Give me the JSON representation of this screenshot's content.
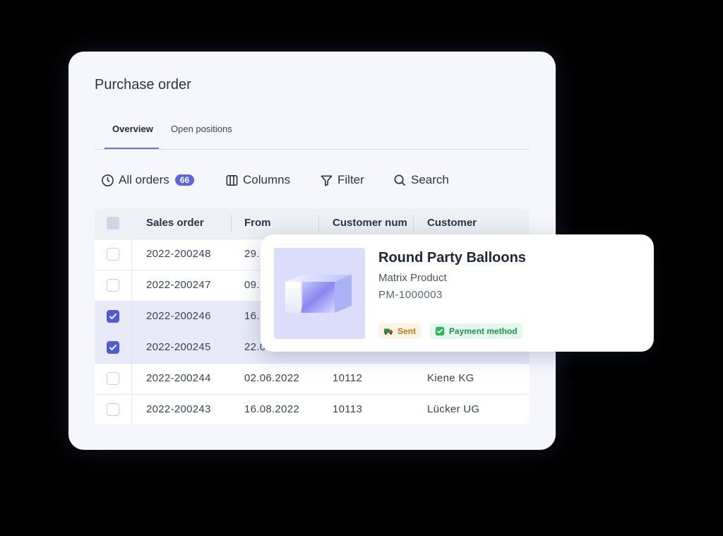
{
  "panel": {
    "title": "Purchase order",
    "tabs": [
      {
        "label": "Overview",
        "active": true
      },
      {
        "label": "Open positions",
        "active": false
      }
    ]
  },
  "toolbar": {
    "all_orders_label": "All orders",
    "all_orders_count": "66",
    "columns_label": "Columns",
    "filter_label": "Filter",
    "search_label": "Search"
  },
  "table": {
    "headers": [
      "Sales order",
      "From",
      "Customer num",
      "Customer"
    ],
    "rows": [
      {
        "sales_order": "2022-200248",
        "from": "29.",
        "customer_num": "",
        "customer": "",
        "checked": false
      },
      {
        "sales_order": "2022-200247",
        "from": "09.",
        "customer_num": "",
        "customer": "",
        "checked": false
      },
      {
        "sales_order": "2022-200246",
        "from": "16.",
        "customer_num": "",
        "customer": "",
        "checked": true
      },
      {
        "sales_order": "2022-200245",
        "from": "22.0",
        "customer_num": "",
        "customer": "",
        "checked": true
      },
      {
        "sales_order": "2022-200244",
        "from": "02.06.2022",
        "customer_num": "10112",
        "customer": "Kiene KG",
        "checked": false
      },
      {
        "sales_order": "2022-200243",
        "from": "16.08.2022",
        "customer_num": "10113",
        "customer": "Lücker UG",
        "checked": false
      }
    ]
  },
  "product_card": {
    "title": "Round Party Balloons",
    "subtitle": "Matrix Product",
    "code": "PM-1000003",
    "chips": [
      {
        "label": "Sent",
        "icon": "truck-icon",
        "color": "#c27a1c"
      },
      {
        "label": "Payment method",
        "icon": "check-box-icon",
        "color": "#1f9255"
      }
    ]
  },
  "colors": {
    "accent": "#5b66d8",
    "panel_bg": "#f6f7fc",
    "selected_row": "#e8eaf8",
    "page_bg": "#000000"
  }
}
